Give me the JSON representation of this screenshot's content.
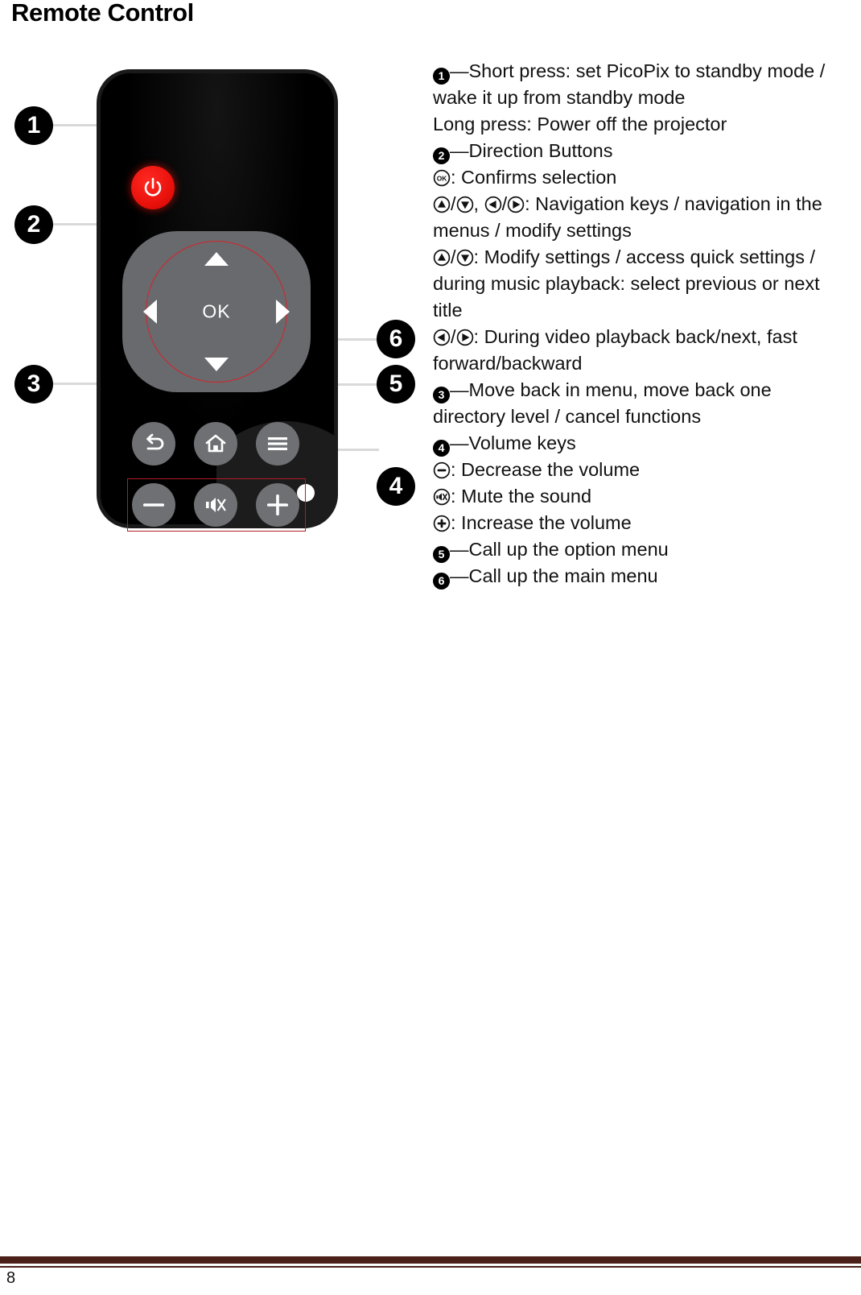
{
  "page": {
    "title": "Remote Control",
    "page_number": "8"
  },
  "colors": {
    "power_button": "#e8100b",
    "dpad_ring": "#d8222b",
    "volume_highlight_box": "#b01e24",
    "button_gray": "#6e7073",
    "dpad_gray": "#686a6d",
    "remote_body": "#000000",
    "footer_rule": "#4b2019",
    "badge": "#000000"
  },
  "figure": {
    "alt": "PicoPix remote control with numbered callouts 1 through 6",
    "remote": {
      "ok_label": "OK",
      "buttons": [
        {
          "name": "power",
          "icon": "power-icon",
          "color": "#e8100b"
        },
        {
          "name": "dpad-up",
          "icon": "triangle-up-icon"
        },
        {
          "name": "dpad-down",
          "icon": "triangle-down-icon"
        },
        {
          "name": "dpad-left",
          "icon": "triangle-left-icon"
        },
        {
          "name": "dpad-right",
          "icon": "triangle-right-icon"
        },
        {
          "name": "ok",
          "icon": "ok-label"
        },
        {
          "name": "back",
          "icon": "back-arrow-icon"
        },
        {
          "name": "home",
          "icon": "home-icon"
        },
        {
          "name": "menu",
          "icon": "hamburger-menu-icon"
        },
        {
          "name": "volume-down",
          "icon": "minus-icon"
        },
        {
          "name": "mute",
          "icon": "mute-speaker-icon"
        },
        {
          "name": "volume-up",
          "icon": "plus-icon"
        }
      ]
    },
    "callouts": [
      {
        "number": "1",
        "target": "power-button"
      },
      {
        "number": "2",
        "target": "direction-pad"
      },
      {
        "number": "3",
        "target": "back-button"
      },
      {
        "number": "4",
        "target": "volume-keys"
      },
      {
        "number": "5",
        "target": "menu-button"
      },
      {
        "number": "6",
        "target": "home-button"
      }
    ]
  },
  "descriptions": {
    "item1": {
      "number": "1",
      "dash": "—",
      "line1": "Short press: set PicoPix to standby mode / wake it up from standby mode",
      "line2": "Long press: Power off the projector"
    },
    "item2": {
      "number": "2",
      "dash": "—",
      "title": "Direction Buttons",
      "ok_text": ": Confirms selection",
      "nav_text": ": Navigation keys / navigation in the menus / modify settings",
      "updown_text": ": Modify settings / access quick settings / during music playback: select previous or next title",
      "leftright_text": ": During video playback back/next, fast forward/backward",
      "slash": "/",
      "comma": ", "
    },
    "item3": {
      "number": "3",
      "dash": "—",
      "text": "Move back in menu, move back one directory level / cancel functions"
    },
    "item4": {
      "number": "4",
      "dash": "—",
      "title": "Volume keys",
      "minus_text": ": Decrease the volume",
      "mute_text": ": Mute the sound",
      "plus_text": ": Increase the volume"
    },
    "item5": {
      "number": "5",
      "dash": "—",
      "text": "Call up the option menu"
    },
    "item6": {
      "number": "6",
      "dash": "—",
      "text": "Call up the main menu"
    }
  }
}
